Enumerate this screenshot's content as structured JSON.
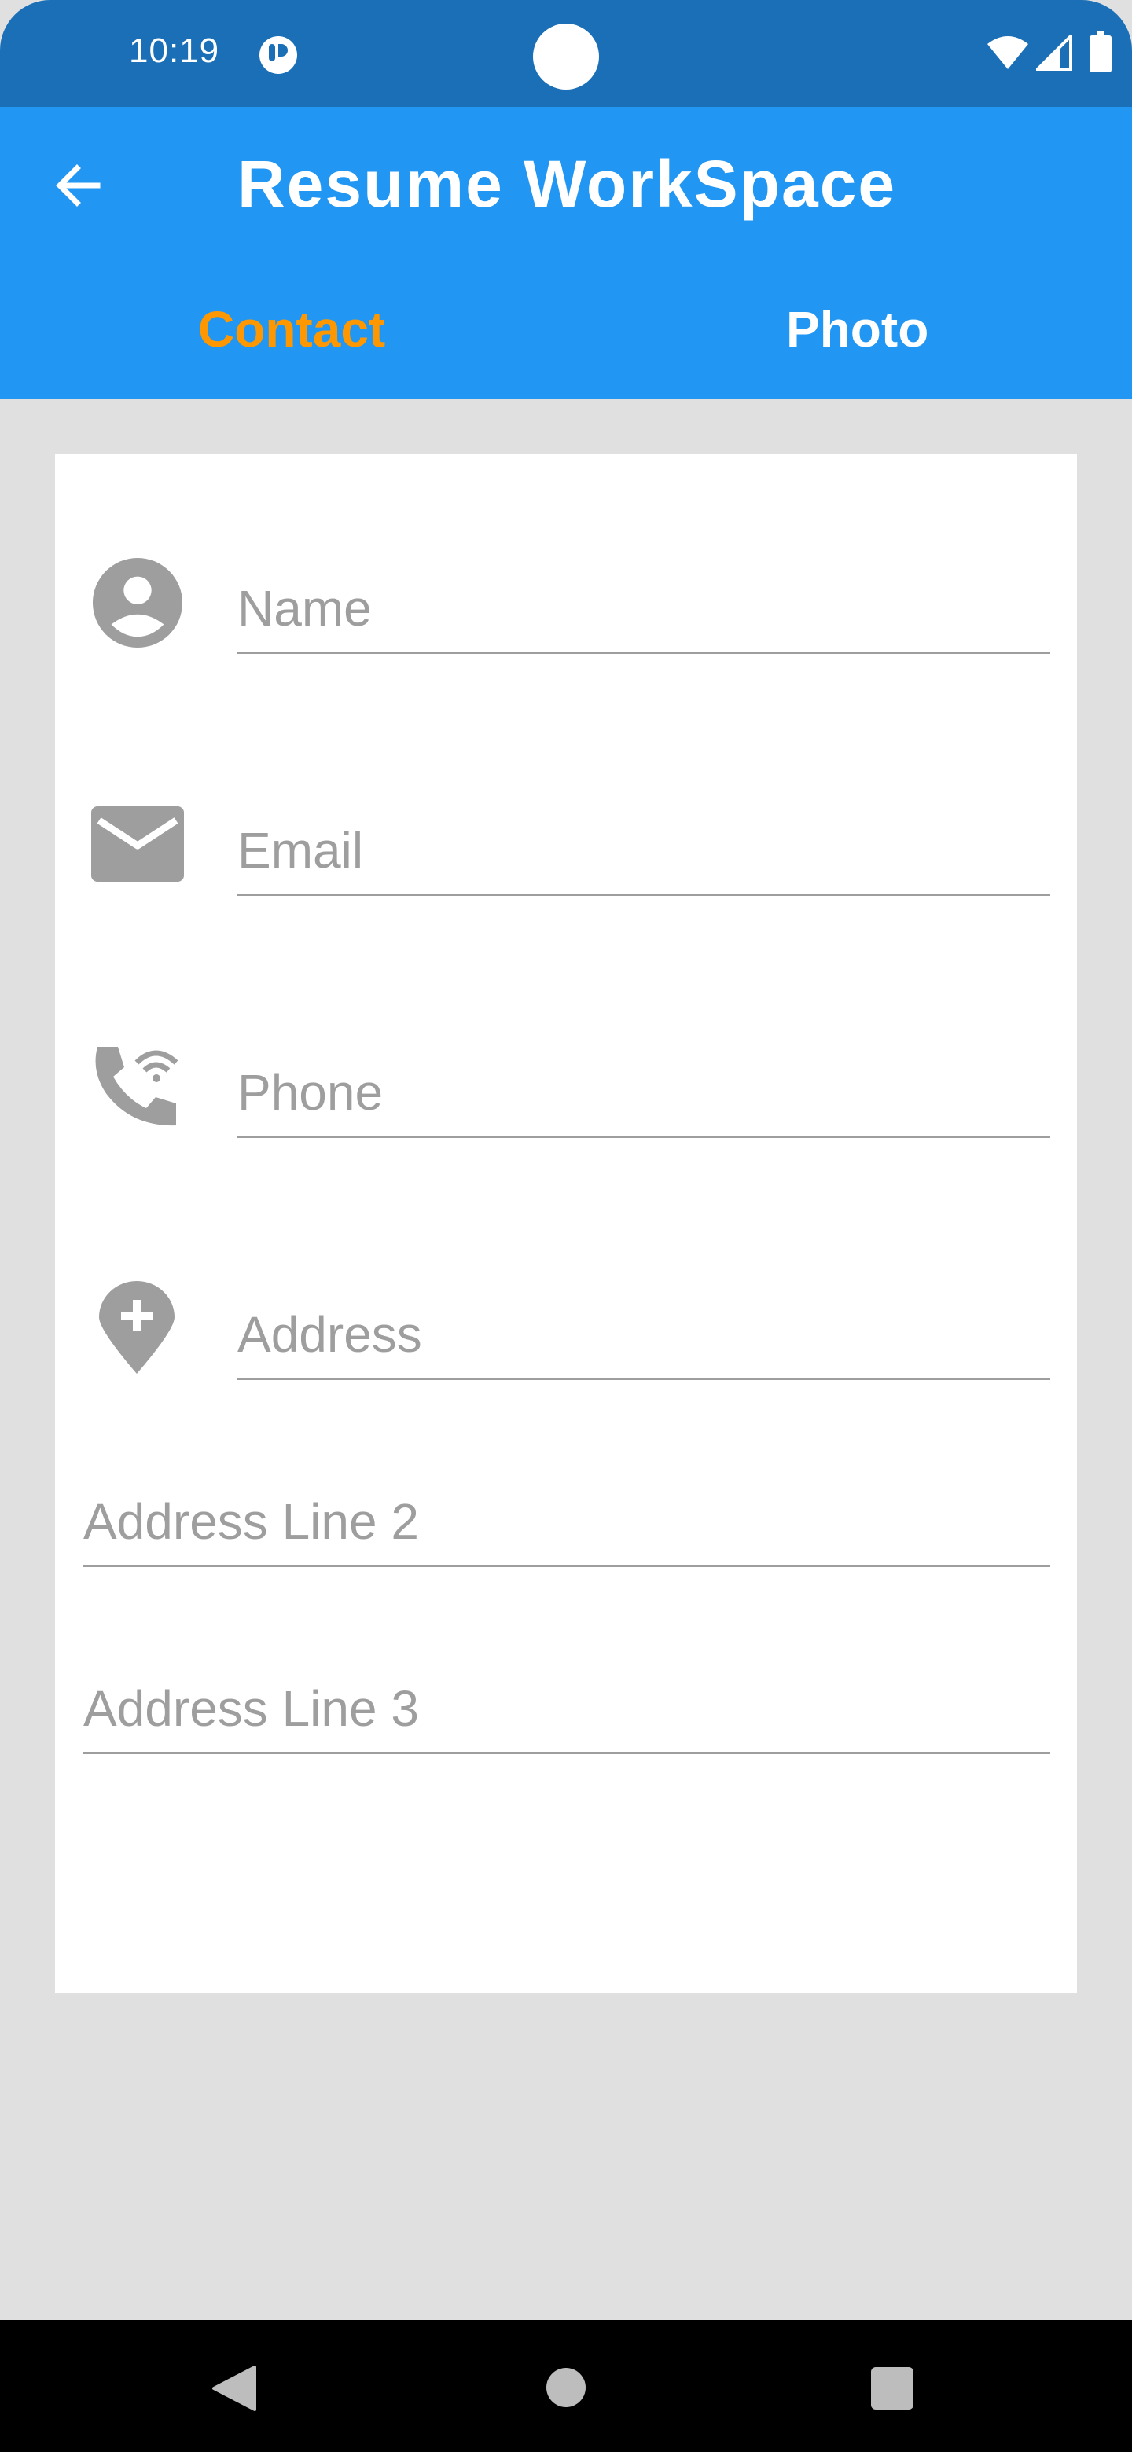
{
  "status_bar": {
    "time": "10:19",
    "icons": [
      "app-notification-icon",
      "wifi-icon",
      "signal-icon",
      "battery-icon"
    ]
  },
  "app_bar": {
    "title": "Resume WorkSpace",
    "back_icon": "arrow-back-icon",
    "tabs": [
      {
        "label": "Contact",
        "selected": true
      },
      {
        "label": "Photo",
        "selected": false
      }
    ]
  },
  "form": {
    "name": {
      "placeholder": "Name",
      "value": "",
      "icon": "account-circle-icon"
    },
    "email": {
      "placeholder": "Email",
      "value": "",
      "icon": "email-icon"
    },
    "phone": {
      "placeholder": "Phone",
      "value": "",
      "icon": "wifi-calling-icon"
    },
    "address": {
      "placeholder": "Address",
      "value": "",
      "icon": "add-location-icon"
    },
    "address_line_2": {
      "placeholder": "Address Line 2",
      "value": ""
    },
    "address_line_3": {
      "placeholder": "Address Line 3",
      "value": ""
    }
  },
  "nav_bar": {
    "icons": [
      "nav-back-icon",
      "nav-home-icon",
      "nav-recents-icon"
    ]
  },
  "colors": {
    "status_bar": "#1a6fb6",
    "app_bar": "#2196f3",
    "tab_selected": "#ff9800",
    "tab_unselected": "#ffffff",
    "background": "#e0e0e0",
    "hint_text": "#9e9e9e"
  }
}
